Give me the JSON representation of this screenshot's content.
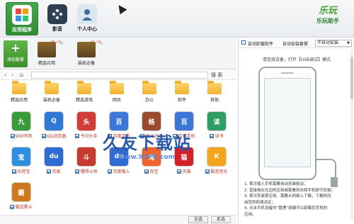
{
  "nav": {
    "items": [
      {
        "label": "应用程序",
        "active": true,
        "icon": "apps-grid-icon"
      },
      {
        "label": "影音",
        "active": false,
        "icon": "film-reel-icon"
      },
      {
        "label": "个人中心",
        "active": false,
        "icon": "user-profile-icon"
      }
    ]
  },
  "logo": {
    "mark": "乐玩",
    "name": "乐玩助手"
  },
  "packages": {
    "add_label": "添加套餐",
    "items": [
      {
        "label": "精选应用",
        "badge": "15 / 0"
      },
      {
        "label": "装机必备",
        "badge": "11 / 0"
      }
    ]
  },
  "toolbar": {
    "search_label": "搜 索"
  },
  "folders": [
    "精选应用",
    "装机必备",
    "精选游戏",
    "网页",
    "办公",
    "软件",
    "其他"
  ],
  "apps": [
    {
      "label": "900市场",
      "checked": true,
      "color": "#3a9b3a",
      "glyph": "九"
    },
    {
      "label": "QQ浏览器",
      "checked": true,
      "color": "#2f7ad6",
      "glyph": "Q"
    },
    {
      "label": "今日头条",
      "checked": true,
      "color": "#d33c36",
      "glyph": "头"
    },
    {
      "label": "百度浏览",
      "checked": true,
      "color": "#3b76d8",
      "glyph": "百"
    },
    {
      "label": "格斗之王",
      "checked": true,
      "color": "#9a4a2f",
      "glyph": "格"
    },
    {
      "label": "百度手机",
      "checked": true,
      "color": "#3b76d8",
      "glyph": "百"
    },
    {
      "label": "读书",
      "checked": true,
      "color": "#2f9e62",
      "glyph": "读"
    },
    {
      "label": "应用宝",
      "checked": true,
      "color": "#2e8ee0",
      "glyph": "宝"
    },
    {
      "label": "百度",
      "checked": true,
      "color": "#2f6bd2",
      "glyph": "du"
    },
    {
      "label": "懂得斗地",
      "checked": true,
      "color": "#c93a2e",
      "glyph": "斗"
    },
    {
      "label": "百度输入",
      "checked": true,
      "color": "#2f6bd2",
      "glyph": "du"
    },
    {
      "label": "淘宝",
      "checked": true,
      "color": "#f0622b",
      "glyph": "淘"
    },
    {
      "label": "天猫",
      "checked": true,
      "color": "#d31f2a",
      "glyph": "猫"
    },
    {
      "label": "酷我音乐",
      "checked": true,
      "color": "#f4a51c",
      "glyph": "K"
    },
    {
      "label": "霸道勇斗",
      "checked": true,
      "color": "#d0781c",
      "glyph": "霸"
    }
  ],
  "bottom": {
    "select_all": "全选",
    "invert": "反选"
  },
  "right": {
    "auto_uninstall": "自动卸载软件",
    "auto_install_label": "自动安装套餐",
    "install_select": "不自动安装",
    "notice": "请连接设备，打开【USB调试】模式",
    "steps": [
      "1.  首次插入手机需要自动安装驱动；",
      "2.  直接拖在左边的应用或套餐到右侧手机即可安装；",
      "3.  首次安装某应用，需要从网络上下载，下载时间",
      "     由您的网速决定；",
      "4.  点击手机设备的“管理”按键可以卸载您手机的",
      "     应用。"
    ]
  },
  "watermark": {
    "text": "久友下载站",
    "url": "www.9UPK.com"
  }
}
